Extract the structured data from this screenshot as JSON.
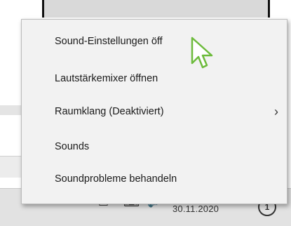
{
  "menu": {
    "items": [
      {
        "label": "Sound-Einstellungen öff",
        "has_submenu": false
      },
      {
        "label": "Lautstärkemixer öffnen",
        "has_submenu": false
      },
      {
        "label": "Raumklang (Deaktiviert)",
        "has_submenu": true
      },
      {
        "label": "Sounds",
        "has_submenu": false
      },
      {
        "label": "Soundprobleme behandeln",
        "has_submenu": false
      }
    ],
    "submenu_arrow": "›"
  },
  "taskbar": {
    "date": "30.11.2020",
    "notification_count": "1",
    "icons": [
      "chevron-up-icon",
      "network-icon",
      "language-icon",
      "volume-icon"
    ]
  },
  "cursor": "arrow-pointer-icon"
}
